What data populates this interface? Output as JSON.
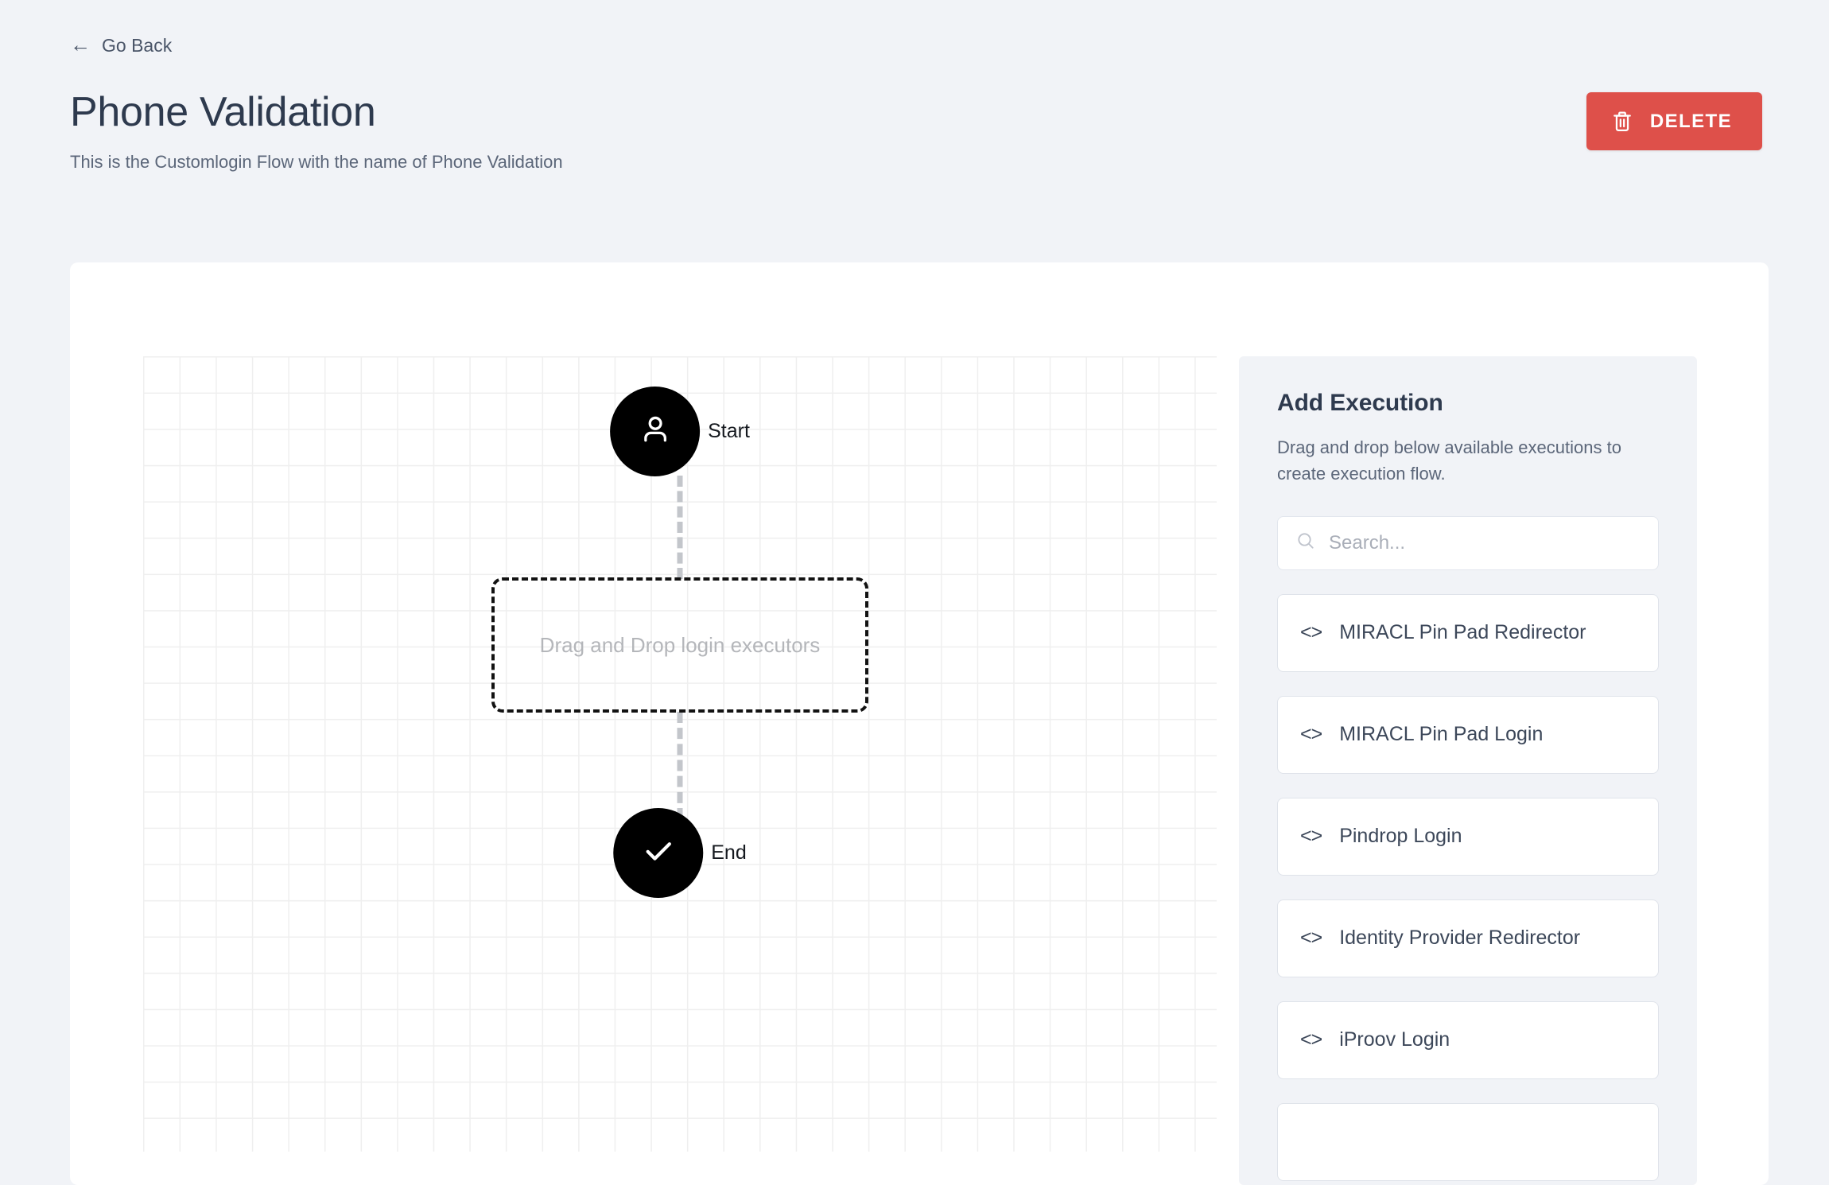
{
  "header": {
    "back_label": "Go Back",
    "back_icon": "arrow-left-icon",
    "title": "Phone Validation",
    "subtitle": "This is the Customlogin Flow with the name of Phone Validation",
    "delete_label": "DELETE",
    "delete_icon": "trash-icon",
    "delete_color": "#DE504A"
  },
  "flow": {
    "start": {
      "label": "Start",
      "icon": "user-icon"
    },
    "end": {
      "label": "End",
      "icon": "check-icon"
    },
    "dropzone": {
      "placeholder": "Drag and Drop login executors"
    }
  },
  "panel": {
    "title": "Add Execution",
    "description": "Drag and drop below available executions to create execution flow.",
    "search": {
      "placeholder": "Search...",
      "value": "",
      "icon": "search-icon"
    },
    "items": [
      {
        "label": "MIRACL Pin Pad Redirector",
        "icon": "code-icon"
      },
      {
        "label": "MIRACL Pin Pad Login",
        "icon": "code-icon"
      },
      {
        "label": "Pindrop Login",
        "icon": "code-icon"
      },
      {
        "label": "Identity Provider Redirector",
        "icon": "code-icon"
      },
      {
        "label": "iProov Login",
        "icon": "code-icon"
      },
      {
        "label": "",
        "icon": "code-icon"
      }
    ]
  }
}
